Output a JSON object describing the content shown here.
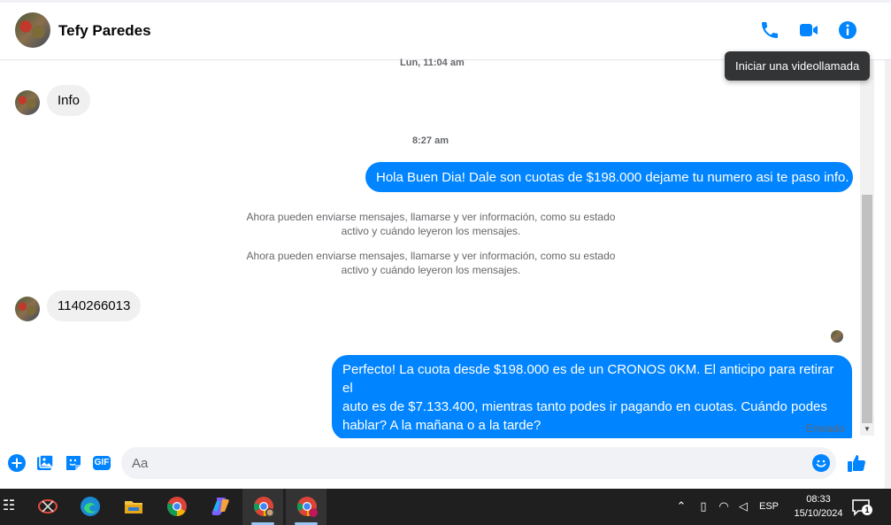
{
  "header": {
    "contact_name": "Tefy Paredes"
  },
  "tooltip": {
    "text": "Iniciar una videollamada"
  },
  "messages": {
    "timestamp_1": "Lun, 11:04 am",
    "info_msg": "Info",
    "timestamp_2": "8:27 am",
    "outgoing_1": "Hola Buen Dia! Dale son cuotas de $198.000 dejame tu numero asi te paso info.",
    "system_1_line1": "Ahora pueden enviarse mensajes, llamarse y ver información, como su estado",
    "system_1_line2": "activo y cuándo leyeron los mensajes.",
    "system_2_line1": "Ahora pueden enviarse mensajes, llamarse y ver información, como su estado",
    "system_2_line2": "activo y cuándo leyeron los mensajes.",
    "phone_msg": "1140266013",
    "outgoing_2_line1": "Perfecto! La cuota desde $198.000 es de un CRONOS 0KM. El anticipo para retirar el",
    "outgoing_2_line2": "auto es de $7.133.400, mientras tanto podes ir pagando en cuotas. Cuándo podes",
    "outgoing_2_line3": "hablar? A la mañana o a la tarde?",
    "status": "Enviado"
  },
  "composer": {
    "placeholder": "Aa",
    "gif_label": "GIF"
  },
  "taskbar": {
    "language": "ESP",
    "time": "08:33",
    "date": "15/10/2024",
    "notification_count": "1"
  },
  "colors": {
    "accent": "#0084ff",
    "incoming_bubble": "#f0f0f0",
    "taskbar": "#1f1f1f"
  }
}
